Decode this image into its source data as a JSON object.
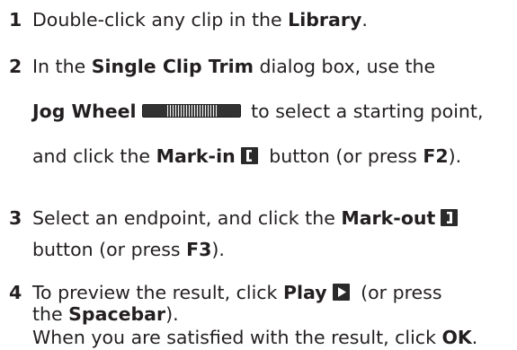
{
  "steps": [
    {
      "number": "1",
      "lines": [
        {
          "t1": "Double-click any clip in the ",
          "b1": "Library",
          "t2": "."
        }
      ]
    },
    {
      "number": "2",
      "lines": [
        {
          "t1": "In the ",
          "b1": "Single Clip Trim",
          "t2": " dialog box, use the"
        },
        {
          "b1": "Jog Wheel",
          "t1": " to select a starting point,"
        },
        {
          "t1": "and click the ",
          "b1": "Mark-in",
          "t2": " button (or press ",
          "b2": "F2",
          "t3": ")."
        }
      ]
    },
    {
      "number": "3",
      "lines": [
        {
          "t1": "Select an endpoint, and click the ",
          "b1": "Mark-out"
        },
        {
          "t1": "button (or press ",
          "b1": "F3",
          "t2": ")."
        }
      ]
    },
    {
      "number": "4",
      "lines": [
        {
          "t1": "To preview the result, click ",
          "b1": "Play",
          "t2": " (or press"
        },
        {
          "t1": "the ",
          "b1": "Spacebar",
          "t2": ")."
        },
        {
          "t1": "When you are satisfied with the result, click ",
          "b1": "OK",
          "t2": "."
        }
      ]
    }
  ],
  "icons": {
    "jog_wheel": "jog-wheel-icon",
    "mark_in": "mark-in-icon",
    "mark_out": "mark-out-icon",
    "play": "play-icon"
  }
}
